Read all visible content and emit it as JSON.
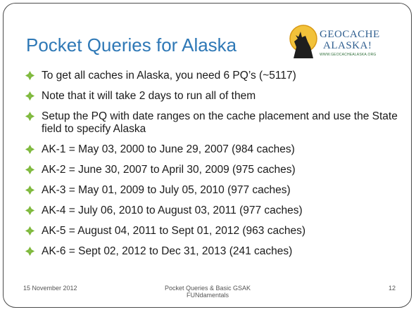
{
  "slide": {
    "title": "Pocket Queries for Alaska",
    "logo": {
      "line1": "GEOCACHE",
      "line2": "ALASKA!",
      "url": "WWW.GEOCACHEALASKA.ORG"
    },
    "bullets": [
      "To get all caches in Alaska, you need 6 PQ’s (~5117)",
      "Note that it will take 2 days to run all of them",
      "Setup the PQ with date ranges on the cache placement and use the State field to specify Alaska",
      "AK-1 = May 03, 2000 to June 29, 2007 (984 caches)",
      "AK-2 = June 30, 2007 to April 30, 2009 (975 caches)",
      "AK-3 = May 01, 2009 to July 05, 2010 (977 caches)",
      "AK-4 = July 06, 2010 to August 03, 2011 (977 caches)",
      "AK-5 = August 04, 2011 to Sept 01, 2012 (963 caches)",
      "AK-6 = Sept 02, 2012 to Dec 31, 2013 (241 caches)"
    ],
    "bullet_icon": "diamond-bullet-icon",
    "colors": {
      "title": "#2e78b6",
      "bullet": "#7db83a"
    }
  },
  "footer": {
    "date": "15 November  2012",
    "center_line1": "Pocket Queries & Basic GSAK",
    "center_line2": "FUNdamentals",
    "page": "12"
  }
}
